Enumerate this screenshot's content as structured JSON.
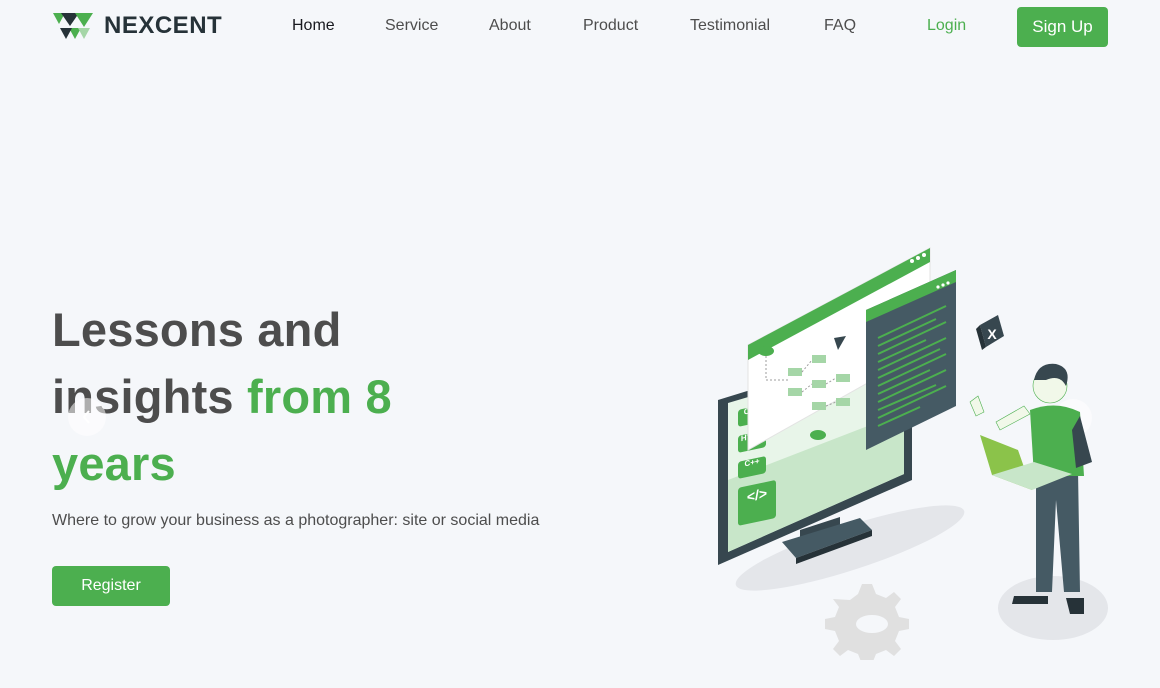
{
  "brand": {
    "name": "NEXCENT"
  },
  "nav": {
    "items": [
      {
        "label": "Home",
        "active": true
      },
      {
        "label": "Service",
        "active": false
      },
      {
        "label": "About",
        "active": false
      },
      {
        "label": "Product",
        "active": false
      },
      {
        "label": "Testimonial",
        "active": false
      },
      {
        "label": "FAQ",
        "active": false
      }
    ],
    "login_label": "Login",
    "signup_label": "Sign Up"
  },
  "hero": {
    "title_line1": "Lessons and",
    "title_line2_plain": "insights ",
    "title_line2_accent": "from 8",
    "title_line3_accent": "years",
    "subtitle": "Where to grow your business as a photographer: site or social media",
    "register_label": "Register"
  },
  "illustration": {
    "tags": [
      "CSS",
      "HTML",
      "C++"
    ],
    "code_icon": "</>",
    "close_icon_glyph": "X"
  },
  "colors": {
    "primary": "#4caf4f",
    "heading": "#4d4d4d",
    "dark": "#263238",
    "background": "#f5f7fa"
  }
}
